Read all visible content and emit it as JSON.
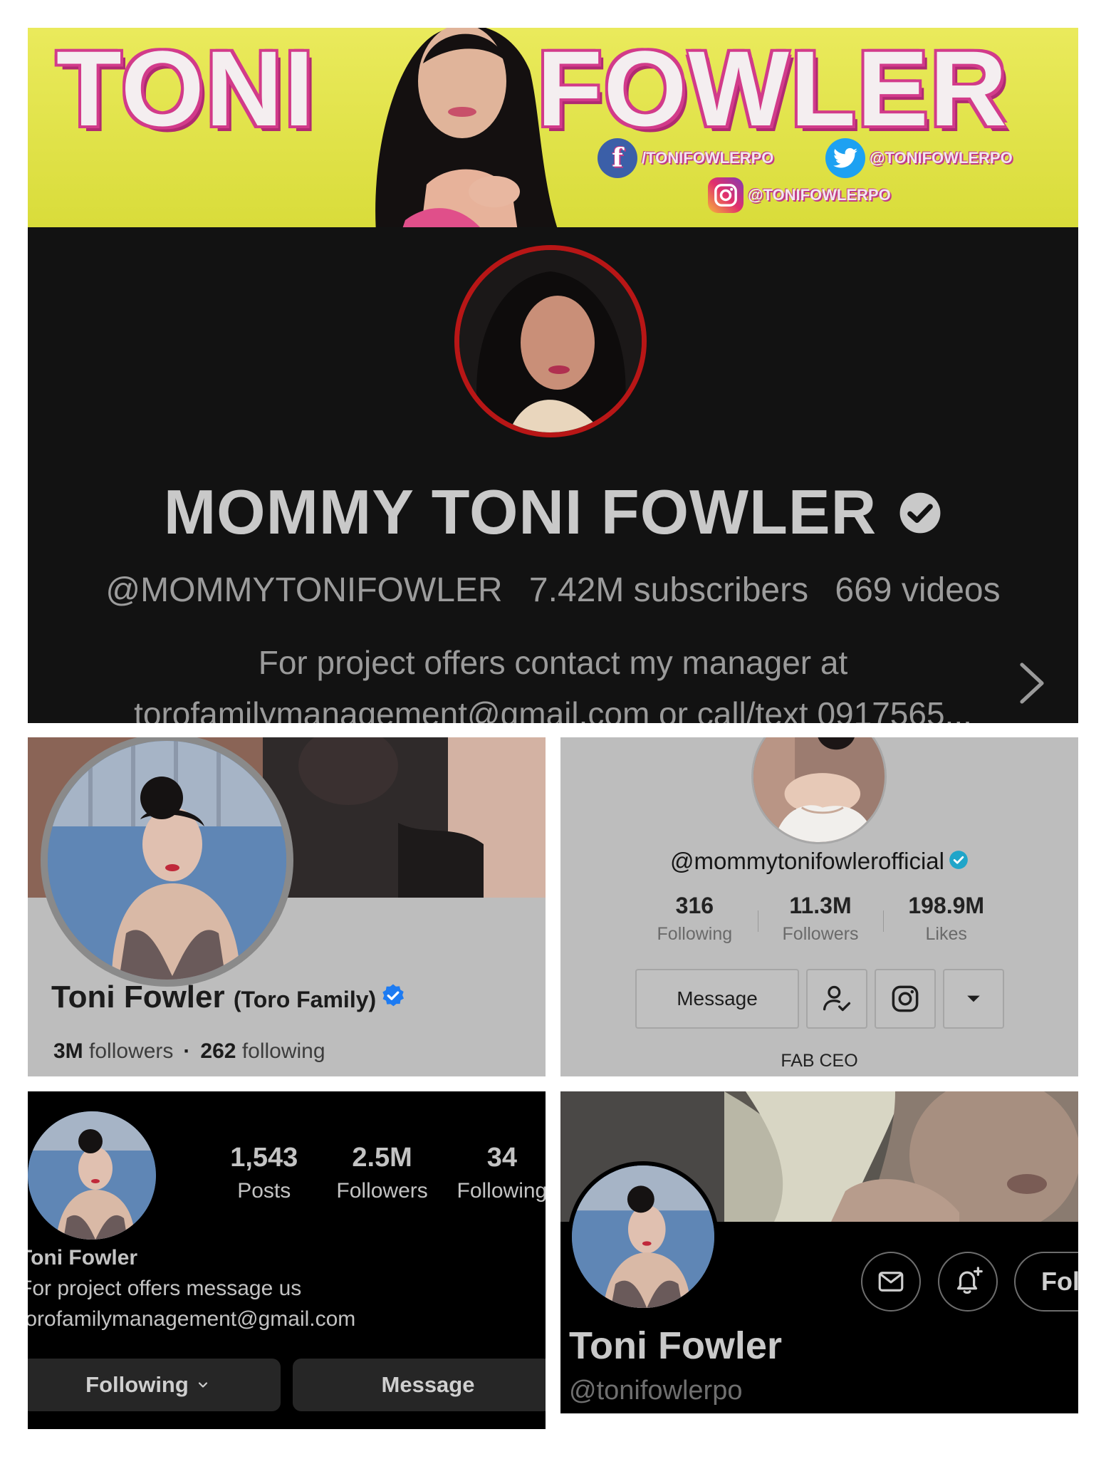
{
  "youtube": {
    "banner_left": "TONI",
    "banner_right": "FOWLER",
    "social_facebook": "/TONIFOWLERPO",
    "social_twitter": "@TONIFOWLERPO",
    "social_instagram": "@TONIFOWLERPO",
    "channel_name": "MOMMY TONI FOWLER",
    "handle": "@MOMMYTONIFOWLER",
    "subscribers": "7.42M subscribers",
    "videos": "669 videos",
    "description_line1": "For project offers contact my manager at",
    "description_line2": "torofamilymanagement@gmail.com or call/text 0917565..."
  },
  "facebook": {
    "name": "Toni Fowler",
    "name_suffix": "(Toro Family)",
    "followers_count": "3M",
    "followers_label": "followers",
    "following_count": "262",
    "following_label": "following"
  },
  "tiktok": {
    "handle": "@mommytonifowlerofficial",
    "stats": [
      {
        "value": "316",
        "label": "Following"
      },
      {
        "value": "11.3M",
        "label": "Followers"
      },
      {
        "value": "198.9M",
        "label": "Likes"
      }
    ],
    "message_button": "Message",
    "bio": "FAB CEO"
  },
  "instagram": {
    "stats": [
      {
        "value": "1,543",
        "label": "Posts"
      },
      {
        "value": "2.5M",
        "label": "Followers"
      },
      {
        "value": "34",
        "label": "Following"
      }
    ],
    "bio_name": "Toni Fowler",
    "bio_line1": "For project offers message us",
    "bio_line2": "torofamilymanagement@gmail.com",
    "following_button": "Following",
    "message_button": "Message"
  },
  "twitter": {
    "follow_button": "Follow",
    "name": "Toni Fowler",
    "handle": "@tonifowlerpo"
  },
  "colors": {
    "youtube_bg": "#121212",
    "youtube_ring": "#b81616",
    "banner_yellow": "#e0e24a",
    "banner_pink": "#d23b8a",
    "verified_blue": "#1d7bf2",
    "panel_gray": "#bdbdbd"
  }
}
